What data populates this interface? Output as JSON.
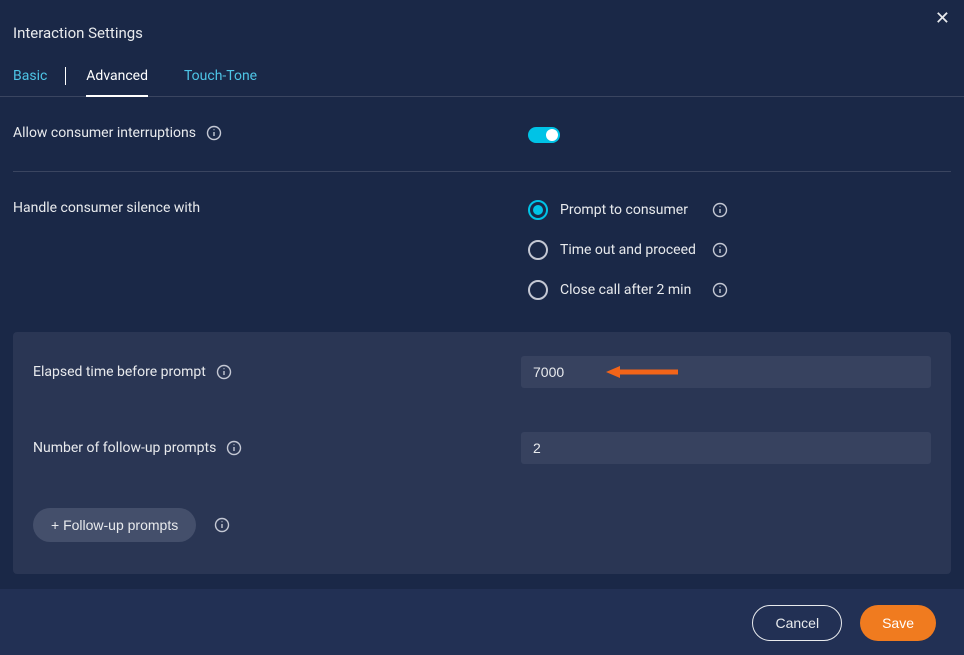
{
  "header": {
    "title": "Interaction Settings"
  },
  "tabs": {
    "basic": "Basic",
    "advanced": "Advanced",
    "touchtone": "Touch-Tone"
  },
  "settings": {
    "allow_interruptions_label": "Allow consumer interruptions",
    "handle_silence_label": "Handle consumer silence with",
    "radio_prompt": "Prompt to consumer",
    "radio_timeout": "Time out and proceed",
    "radio_close": "Close call after 2 min"
  },
  "panel": {
    "elapsed_label": "Elapsed time before prompt",
    "elapsed_value": "7000",
    "followup_count_label": "Number of follow-up prompts",
    "followup_count_value": "2",
    "followup_button": "+ Follow-up prompts"
  },
  "footer": {
    "cancel": "Cancel",
    "save": "Save"
  },
  "colors": {
    "accent": "#00c3e6",
    "primary_btn": "#f07b1f",
    "arrow": "#f26419"
  }
}
